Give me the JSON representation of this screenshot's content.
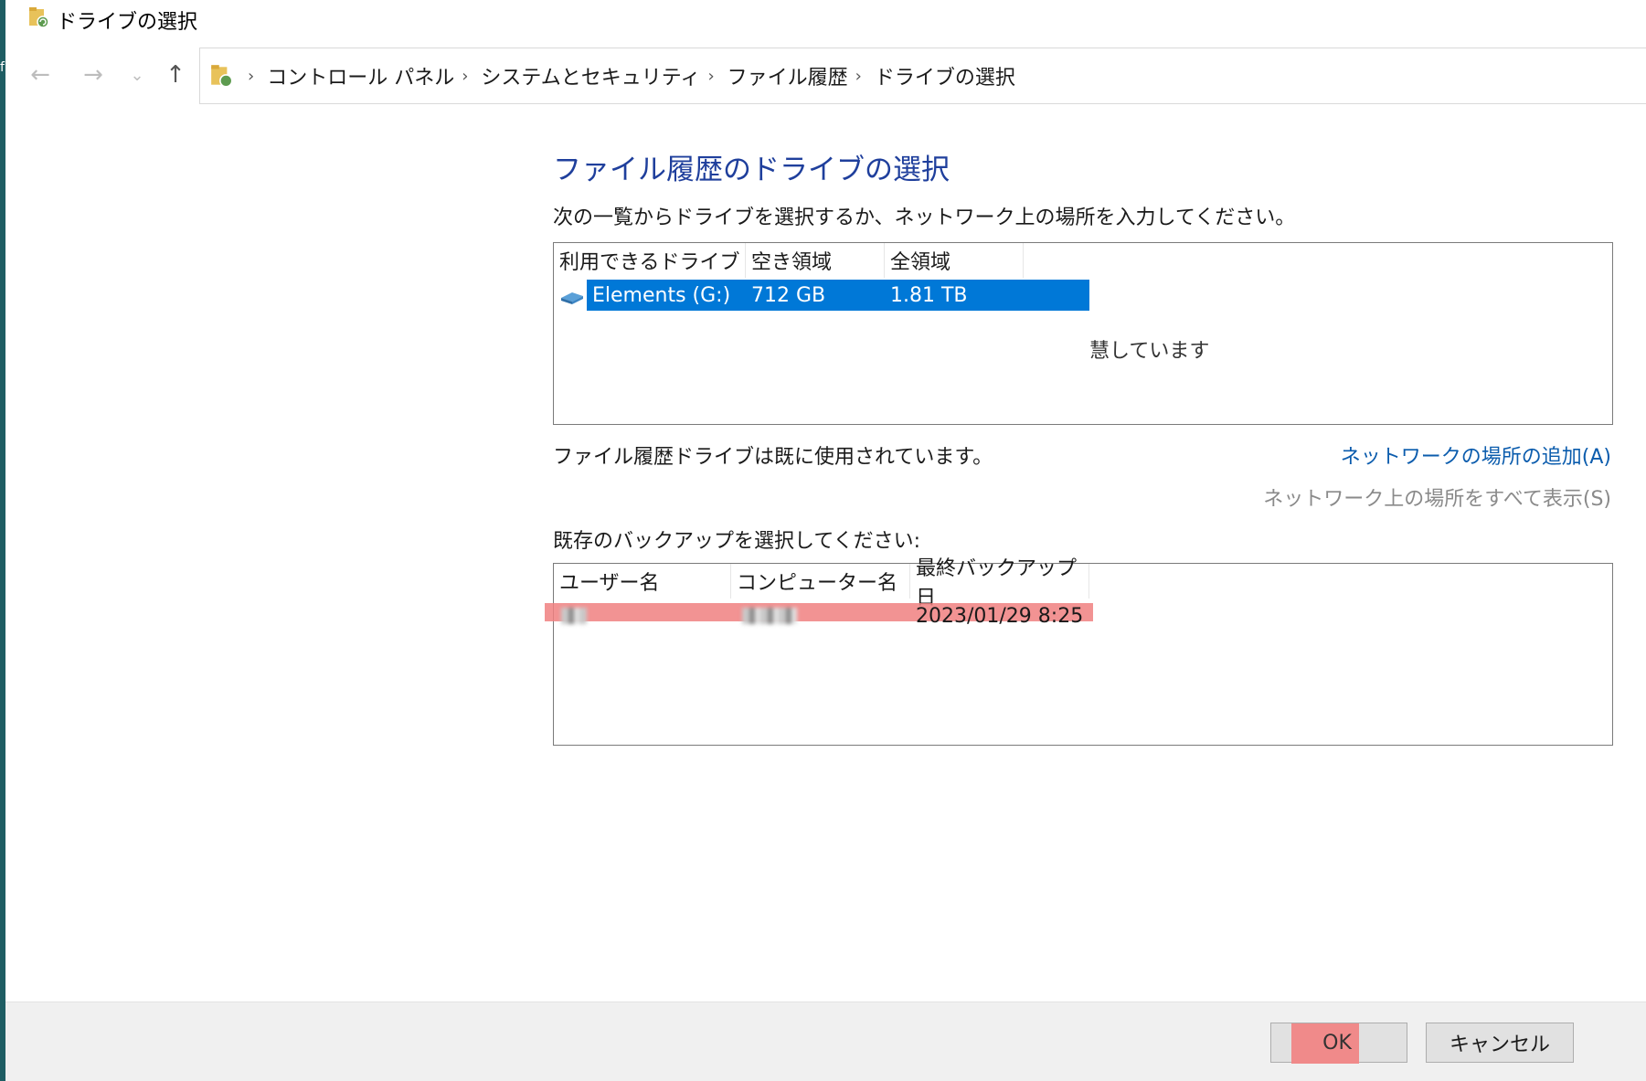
{
  "window": {
    "title": "ドライブの選択",
    "left_edge_glyph": "f"
  },
  "breadcrumb": [
    "コントロール パネル",
    "システムとセキュリティ",
    "ファイル履歴",
    "ドライブの選択"
  ],
  "main": {
    "heading": "ファイル履歴のドライブの選択",
    "instruction": "次の一覧からドライブを選択するか、ネットワーク上の場所を入力してください。",
    "drive_columns": [
      "利用できるドライブ",
      "空き領域",
      "全領域"
    ],
    "drives": [
      {
        "name": "Elements (G:)",
        "free": "712 GB",
        "total": "1.81 TB"
      }
    ],
    "ghost_text": "慧しています",
    "status": "ファイル履歴ドライブは既に使用されています。",
    "add_network_link": "ネットワークの場所の追加(A)",
    "show_all_network_link": "ネットワーク上の場所をすべて表示(S)",
    "backup_label": "既存のバックアップを選択してください:",
    "backup_columns": [
      "ユーザー名",
      "コンピューター名",
      "最終バックアップ日"
    ],
    "backups": [
      {
        "last_backup": "2023/01/29 8:25"
      }
    ]
  },
  "footer": {
    "ok_label": "OK",
    "cancel_label": "キャンセル"
  },
  "colors": {
    "heading": "#1f3f9c",
    "selection": "#0078d7",
    "link": "#0b5cad",
    "highlight": "#f08080"
  }
}
